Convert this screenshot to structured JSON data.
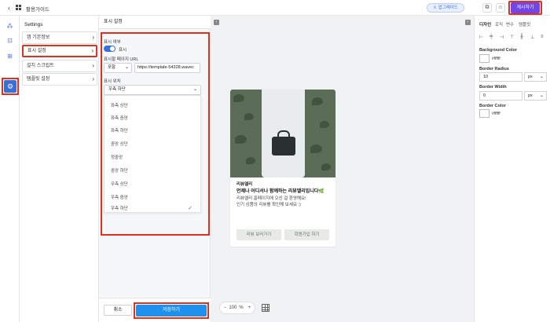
{
  "topbar": {
    "back_icon": "chevron-left-icon",
    "apps_icon": "grid-icon",
    "title": "활용가이드",
    "upgrade_label": "♕ 업그레이드",
    "publish_label": "게시하기"
  },
  "rail": {
    "items": [
      "layout-icon",
      "grid-icon",
      "table-icon",
      "gear-icon"
    ]
  },
  "settings": {
    "title": "Settings",
    "items": [
      {
        "label": "앱 기본정보"
      },
      {
        "label": "표시 설정"
      },
      {
        "label": "설치 스크립트"
      },
      {
        "label": "템플릿 설정"
      }
    ]
  },
  "panel": {
    "header": "표시 설정",
    "visible_label": "표시 여부",
    "toggle_text": "표시",
    "page_url_label": "표시할 페이지 URL",
    "match_value": "포함",
    "url_value": "https://template-54328.wavec",
    "position_label": "표시 위치",
    "position_value": "우측 하단",
    "options": [
      "좌측 상단",
      "좌측 중앙",
      "좌측 하단",
      "중앙 상단",
      "정중앙",
      "중앙 하단",
      "우측 상단",
      "우측 중앙",
      "우측 하단"
    ],
    "selected_option": "우측 하단",
    "cancel_label": "취소",
    "save_label": "저장하기"
  },
  "preview": {
    "name": "리뷰엘리",
    "headline": "언제나 어디서나 함께하는 리뷰엘리입니다🌿",
    "line1": "리뷰엘리 홈페이지에 오신 걸 환영해요!",
    "line2": "인기 상품의 리뷰를 확인해 보세요 :)",
    "btn_reviews": "리뷰 보러가기",
    "btn_signup": "회원가입 하기"
  },
  "zoom": {
    "minus": "−",
    "value": "100",
    "unit": "%",
    "plus": "+"
  },
  "design": {
    "tabs": [
      "디자인",
      "로직",
      "변수",
      "템플릿"
    ],
    "bg_color_label": "Background Color",
    "bg_color_value": "#ffffff",
    "radius_label": "Border Radius",
    "radius_value": "10",
    "radius_unit": "px",
    "width_label": "Border Width",
    "width_value": "0",
    "width_unit": "px",
    "border_color_label": "Border Color",
    "border_color_value": "#ffffff"
  },
  "colors": {
    "accent": "#3b6fd8",
    "publish": "#7046e6",
    "save": "#1e90ee",
    "highlight": "#e0301e"
  }
}
